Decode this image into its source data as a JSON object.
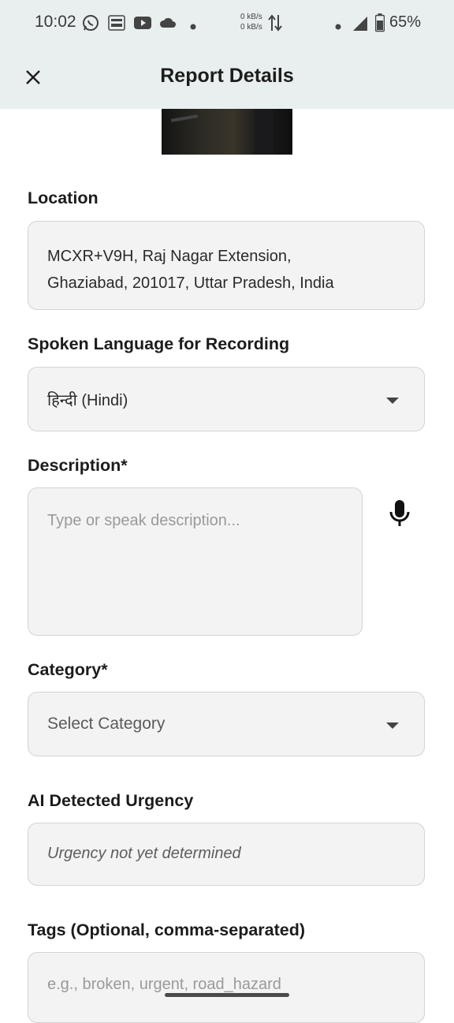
{
  "status_bar": {
    "time": "10:02",
    "speed_up": "0 kB/s",
    "speed_down": "0 kB/s",
    "battery": "65%"
  },
  "app_bar": {
    "title": "Report Details"
  },
  "location": {
    "label": "Location",
    "line1": "MCXR+V9H, Raj Nagar Extension,",
    "line2": "Ghaziabad, 201017, Uttar Pradesh, India"
  },
  "language": {
    "label": "Spoken Language for Recording",
    "selected": "हिन्दी (Hindi)"
  },
  "description": {
    "label": "Description*",
    "placeholder": "Type or speak description..."
  },
  "category": {
    "label": "Category*",
    "selected": "Select Category"
  },
  "urgency": {
    "label": "AI Detected Urgency",
    "value": "Urgency not yet determined"
  },
  "tags": {
    "label": "Tags (Optional, comma-separated)",
    "placeholder": "e.g., broken, urgent, road_hazard"
  }
}
